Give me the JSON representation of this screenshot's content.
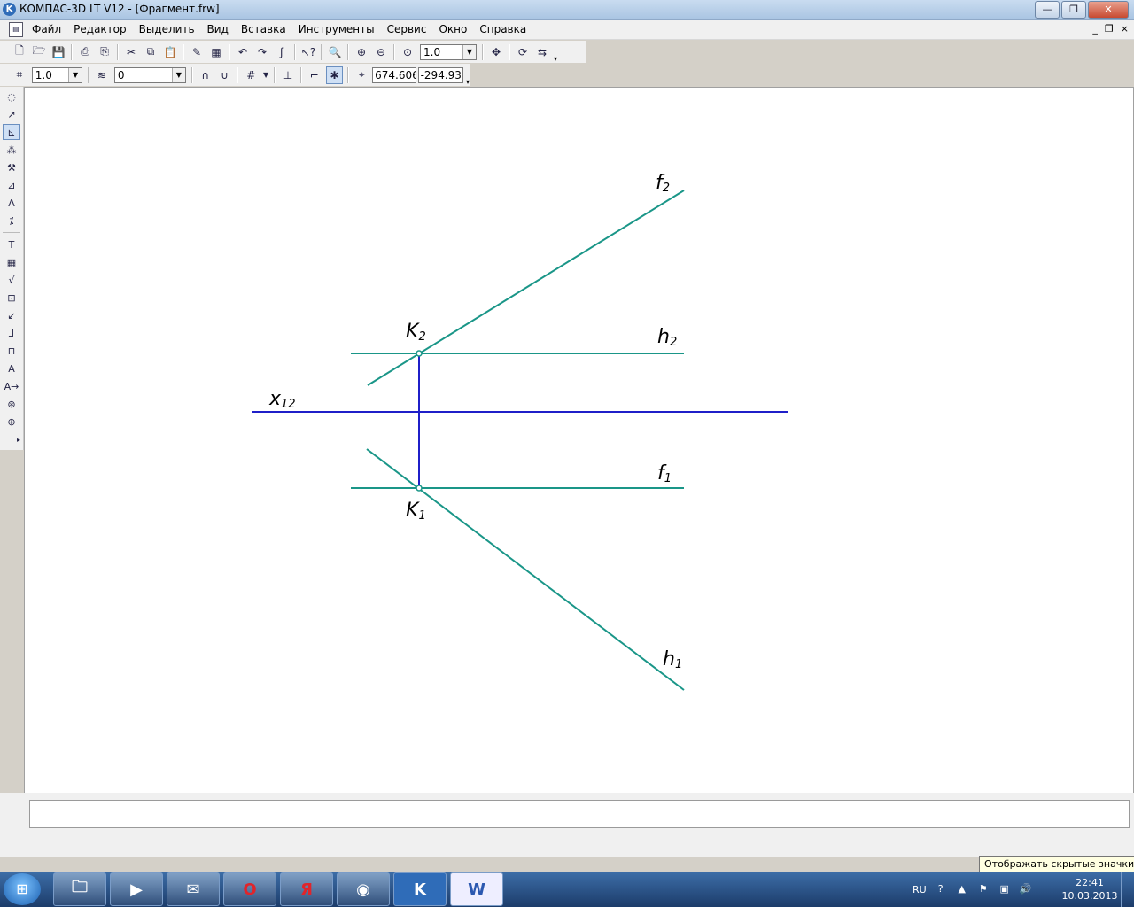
{
  "window": {
    "title": "КОМПАС-3D LT V12 - [Фрагмент.frw]",
    "minimize_glyph": "—",
    "maximize_glyph": "❐",
    "close_glyph": "✕"
  },
  "menu": {
    "items": [
      "Файл",
      "Редактор",
      "Выделить",
      "Вид",
      "Вставка",
      "Инструменты",
      "Сервис",
      "Окно",
      "Справка"
    ],
    "mdi_min": "_",
    "mdi_restore": "❐",
    "mdi_close": "×"
  },
  "toolbar1": {
    "zoom_value": "1.0"
  },
  "toolbar2": {
    "step_value": "1.0",
    "layer_value": "0",
    "coord_x": "674.606",
    "coord_y": "-294.93"
  },
  "drawing": {
    "labels": {
      "f2": "f2",
      "k2": "K2",
      "h2": "h2",
      "x12": "x12",
      "f1": "f1",
      "k1": "K1",
      "h1": "h1"
    },
    "line_color": "#1a9688",
    "axis_color": "#1f1fc8"
  },
  "status": {
    "message": ""
  },
  "tooltip": {
    "text": "Отображать скрытые значки"
  },
  "taskbar": {
    "start_glyph": "⊞",
    "apps": [
      {
        "name": "explorer",
        "glyph": "🗀"
      },
      {
        "name": "media-player",
        "glyph": "▶"
      },
      {
        "name": "mail",
        "glyph": "✉"
      },
      {
        "name": "opera",
        "glyph": "O"
      },
      {
        "name": "yandex",
        "glyph": "Я"
      },
      {
        "name": "chrome",
        "glyph": "◉"
      },
      {
        "name": "kompas",
        "glyph": "K"
      },
      {
        "name": "word",
        "glyph": "W"
      }
    ],
    "language": "RU",
    "time": "22:41",
    "date": "10.03.2013"
  }
}
